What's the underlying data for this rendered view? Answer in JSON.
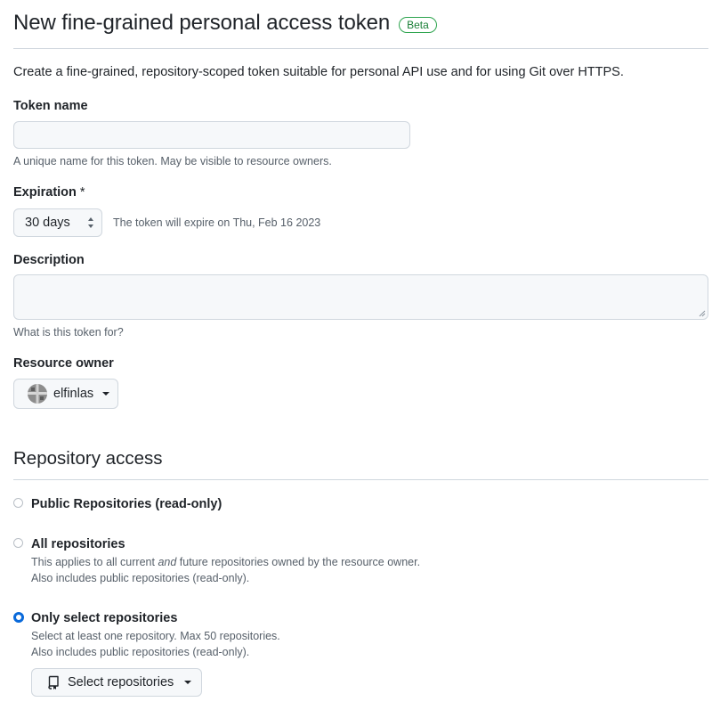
{
  "header": {
    "title": "New fine-grained personal access token",
    "badge": "Beta",
    "intro": "Create a fine-grained, repository-scoped token suitable for personal API use and for using Git over HTTPS."
  },
  "token_name": {
    "label": "Token name",
    "value": "",
    "placeholder": "",
    "note": "A unique name for this token. May be visible to resource owners."
  },
  "expiration": {
    "label": "Expiration",
    "required_marker": "*",
    "selected": "30 days",
    "note": "The token will expire on Thu, Feb 16 2023",
    "icon": "select-arrows-icon"
  },
  "description": {
    "label": "Description",
    "value": "",
    "note": "What is this token for?"
  },
  "resource_owner": {
    "label": "Resource owner",
    "selected": "elfinlas",
    "icon": "avatar"
  },
  "repository_access": {
    "title": "Repository access",
    "options": [
      {
        "label": "Public Repositories (read-only)",
        "checked": false
      },
      {
        "label": "All repositories",
        "checked": false,
        "note_before": "This applies to all current ",
        "note_em": "and",
        "note_after": " future repositories owned by the resource owner.",
        "note2": "Also includes public repositories (read-only)."
      },
      {
        "label": "Only select repositories",
        "checked": true,
        "note": "Select at least one repository. Max 50 repositories.",
        "note2": "Also includes public repositories (read-only)."
      }
    ],
    "select_button": {
      "label": "Select repositories",
      "icon": "repo-icon"
    }
  },
  "colors": {
    "accent": "#0969da",
    "badge": "#1a7f37",
    "border": "#d0d7de",
    "muted_text": "#57606a"
  }
}
